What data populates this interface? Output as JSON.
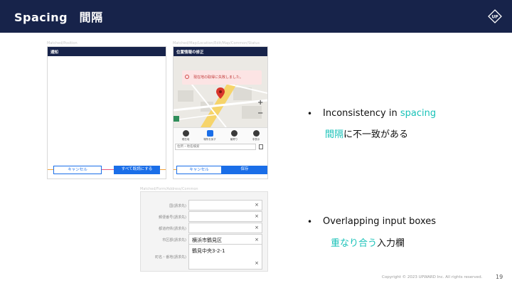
{
  "header": {
    "title": "Spacing　間隔"
  },
  "screen_a": {
    "frame_label": "Matched/Position",
    "title": "通知",
    "cancel": "キャンセル",
    "confirm": "すべて既読にする"
  },
  "screen_b": {
    "frame_label": "Matched/Map/Location/Edit/Map/Common/Status",
    "title": "位置情報の修正",
    "error": "現在地の取得に失敗しました。",
    "zoom_in": "+",
    "zoom_out": "−",
    "icons": [
      {
        "label": "現在地"
      },
      {
        "label": "場所を探す"
      },
      {
        "label": "最寄り"
      },
      {
        "label": "非表示"
      }
    ],
    "address_placeholder": "住所・地名検索",
    "cancel": "キャンセル",
    "save": "保存"
  },
  "form": {
    "frame_label": "Matched/Form/Address/Common",
    "rows": [
      {
        "label": "国(請求先)",
        "value": ""
      },
      {
        "label": "郵便番号(請求先)",
        "value": ""
      },
      {
        "label": "都道府県(請求先)",
        "value": ""
      },
      {
        "label": "市区郡(請求先)",
        "value": "横浜市鶴見区"
      },
      {
        "label": "町名・番地(請求先)",
        "value": "鶴見中央3-2-1"
      }
    ],
    "clear": "×"
  },
  "bullets": [
    {
      "en_pre": "Inconsistency in ",
      "en_hl": "spacing",
      "ja_hl": "間隔",
      "ja_rest": "に不一致がある"
    },
    {
      "en_pre": "Overlapping input boxes",
      "en_hl": "",
      "ja_hl": "重なり合う",
      "ja_rest": "入力欄"
    }
  ],
  "bullet_symbol": "•",
  "footer": {
    "copyright": "Copyright © 2023 UPWARD Inc. All rights reserved.",
    "page": "19"
  },
  "colors": {
    "header_bg": "#17234a",
    "accent": "#1a6ee8",
    "highlight": "#19c2b8",
    "error_bg": "#fce4e4",
    "spacing_marker": "#e8577a"
  }
}
